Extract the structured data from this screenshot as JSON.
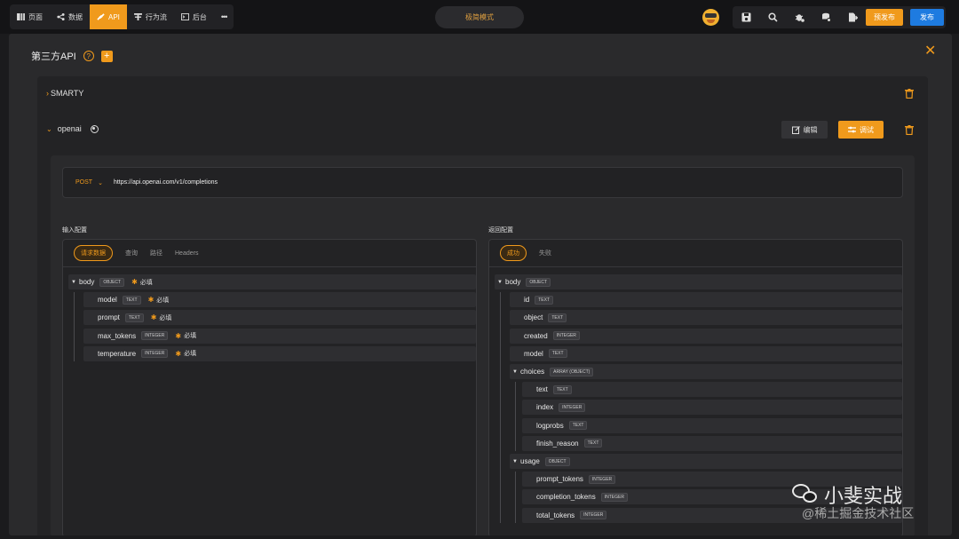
{
  "topbar": {
    "nav": [
      {
        "label": "页面",
        "icon": "page-icon",
        "active": false
      },
      {
        "label": "数据",
        "icon": "share-nodes-icon",
        "active": false
      },
      {
        "label": "API",
        "icon": "link-icon",
        "active": true
      },
      {
        "label": "行为流",
        "icon": "flow-icon",
        "active": false
      },
      {
        "label": "后台",
        "icon": "console-icon",
        "active": false
      }
    ],
    "more": "•••",
    "mode_label": "极简模式",
    "tools": [
      "save-icon",
      "search-icon",
      "bug-icon",
      "database-gear-icon",
      "file-export-icon"
    ],
    "pre_publish": "预发布",
    "publish": "发布",
    "accent": "#f09a1c",
    "blue": "#1e7be0"
  },
  "modal": {
    "title": "第三方API",
    "help": "?",
    "add": "+",
    "close": "✕",
    "apis": [
      {
        "name": "SMARTY",
        "expanded": false
      },
      {
        "name": "openai",
        "expanded": true
      }
    ],
    "edit_label": "编辑",
    "test_label": "调试",
    "request": {
      "method": "POST",
      "url": "https://api.openai.com/v1/completions"
    },
    "input": {
      "label": "输入配置",
      "tabs": [
        "请求数据",
        "查询",
        "路径",
        "Headers"
      ],
      "active_tab": 0,
      "required_label": "必填",
      "tree": [
        {
          "name": "body",
          "type": "OBJECT",
          "required": true,
          "level": 0,
          "caret": true
        },
        {
          "name": "model",
          "type": "TEXT",
          "required": true,
          "level": 1
        },
        {
          "name": "prompt",
          "type": "TEXT",
          "required": true,
          "level": 1
        },
        {
          "name": "max_tokens",
          "type": "INTEGER",
          "required": true,
          "level": 1
        },
        {
          "name": "temperature",
          "type": "INTEGER",
          "required": true,
          "level": 1
        }
      ]
    },
    "output": {
      "label": "返回配置",
      "tabs": [
        "成功",
        "失败"
      ],
      "active_tab": 0,
      "tree": [
        {
          "name": "body",
          "type": "OBJECT",
          "level": 0,
          "caret": true
        },
        {
          "name": "id",
          "type": "TEXT",
          "level": 1
        },
        {
          "name": "object",
          "type": "TEXT",
          "level": 1
        },
        {
          "name": "created",
          "type": "INTEGER",
          "level": 1
        },
        {
          "name": "model",
          "type": "TEXT",
          "level": 1
        },
        {
          "name": "choices",
          "type": "ARRAY (OBJECT)",
          "level": 1,
          "caret": true
        },
        {
          "name": "text",
          "type": "TEXT",
          "level": 2
        },
        {
          "name": "index",
          "type": "INTEGER",
          "level": 2
        },
        {
          "name": "logprobs",
          "type": "TEXT",
          "level": 2
        },
        {
          "name": "finish_reason",
          "type": "TEXT",
          "level": 2
        },
        {
          "name": "usage",
          "type": "OBJECT",
          "level": 1,
          "caret": true
        },
        {
          "name": "prompt_tokens",
          "type": "INTEGER",
          "level": 2
        },
        {
          "name": "completion_tokens",
          "type": "INTEGER",
          "level": 2
        },
        {
          "name": "total_tokens",
          "type": "INTEGER",
          "level": 2
        }
      ]
    }
  },
  "watermark": {
    "main": "小斐实战",
    "sub": "@稀土掘金技术社区"
  }
}
